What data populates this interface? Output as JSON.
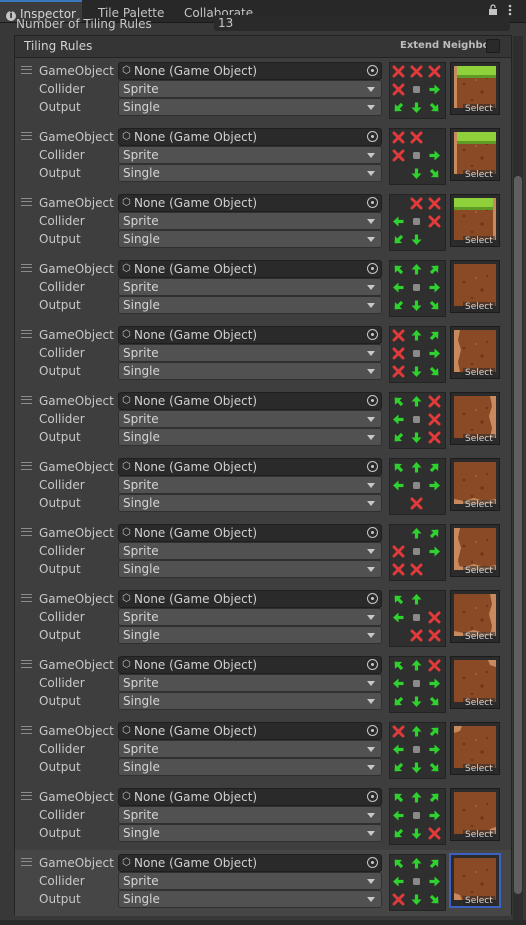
{
  "tabs": [
    {
      "label": "Inspector",
      "active": true
    },
    {
      "label": "Tile Palette",
      "active": false
    },
    {
      "label": "Collaborate",
      "active": false
    }
  ],
  "window_icons": {
    "lock": "lock-icon",
    "menu": "kebab-menu-icon"
  },
  "number_of_rules": {
    "label": "Number of Tiling Rules",
    "value": "13"
  },
  "tiling_rules": {
    "title": "Tiling Rules",
    "extend_neighbor_label": "Extend Neighbor",
    "extend_neighbor_checked": false
  },
  "field_labels": {
    "gameobject": "GameObject",
    "collider": "Collider",
    "output": "Output",
    "select": "Select"
  },
  "colors": {
    "accent": "#3a79bb",
    "arrow_green": "#2fd12f",
    "x_red": "#e23a3a",
    "grass": "#8fd13a",
    "dirt": "#8a4a26"
  },
  "rules": [
    {
      "gameobject": "None (Game Object)",
      "collider": "Sprite",
      "output": "Single",
      "neighbors": [
        "x",
        "x",
        "x",
        "x",
        "c",
        "right",
        "downleft",
        "down",
        "downright"
      ],
      "sprite": "grass-top-left",
      "selected": false
    },
    {
      "gameobject": "None (Game Object)",
      "collider": "Sprite",
      "output": "Single",
      "neighbors": [
        "x",
        "x",
        "",
        "x",
        "c",
        "right",
        "",
        "down",
        "downright"
      ],
      "sprite": "grass-top-left-edge",
      "selected": false
    },
    {
      "gameobject": "None (Game Object)",
      "collider": "Sprite",
      "output": "Single",
      "neighbors": [
        "",
        "x",
        "x",
        "left",
        "c",
        "x",
        "downleft",
        "down",
        ""
      ],
      "sprite": "grass-top-right",
      "selected": false
    },
    {
      "gameobject": "None (Game Object)",
      "collider": "Sprite",
      "output": "Single",
      "neighbors": [
        "upleft",
        "up",
        "upright",
        "left",
        "c",
        "right",
        "downleft",
        "down",
        "downright"
      ],
      "sprite": "dirt-center",
      "selected": false
    },
    {
      "gameobject": "None (Game Object)",
      "collider": "Sprite",
      "output": "Single",
      "neighbors": [
        "x",
        "up",
        "upright",
        "x",
        "c",
        "right",
        "x",
        "down",
        "downright"
      ],
      "sprite": "dirt-left-edge",
      "selected": false
    },
    {
      "gameobject": "None (Game Object)",
      "collider": "Sprite",
      "output": "Single",
      "neighbors": [
        "upleft",
        "up",
        "x",
        "left",
        "c",
        "x",
        "downleft",
        "down",
        "x"
      ],
      "sprite": "dirt-right-edge",
      "selected": false
    },
    {
      "gameobject": "None (Game Object)",
      "collider": "Sprite",
      "output": "Single",
      "neighbors": [
        "upleft",
        "up",
        "upright",
        "left",
        "c",
        "right",
        "",
        "x",
        ""
      ],
      "sprite": "dirt-bottom",
      "selected": false
    },
    {
      "gameobject": "None (Game Object)",
      "collider": "Sprite",
      "output": "Single",
      "neighbors": [
        "",
        "up",
        "upright",
        "x",
        "c",
        "right",
        "x",
        "x",
        ""
      ],
      "sprite": "dirt-bottom-left",
      "selected": false
    },
    {
      "gameobject": "None (Game Object)",
      "collider": "Sprite",
      "output": "Single",
      "neighbors": [
        "upleft",
        "up",
        "",
        "left",
        "c",
        "x",
        "",
        "x",
        "x"
      ],
      "sprite": "dirt-bottom-right",
      "selected": false
    },
    {
      "gameobject": "None (Game Object)",
      "collider": "Sprite",
      "output": "Single",
      "neighbors": [
        "upleft",
        "up",
        "x",
        "left",
        "c",
        "right",
        "downleft",
        "down",
        "downright"
      ],
      "sprite": "dirt-inner-top-right",
      "selected": false
    },
    {
      "gameobject": "None (Game Object)",
      "collider": "Sprite",
      "output": "Single",
      "neighbors": [
        "x",
        "up",
        "upright",
        "left",
        "c",
        "right",
        "downleft",
        "down",
        "downright"
      ],
      "sprite": "dirt-inner-top-left",
      "selected": false
    },
    {
      "gameobject": "None (Game Object)",
      "collider": "Sprite",
      "output": "Single",
      "neighbors": [
        "upleft",
        "up",
        "upright",
        "left",
        "c",
        "right",
        "downleft",
        "down",
        "x"
      ],
      "sprite": "dirt-inner-bottom-right",
      "selected": false
    },
    {
      "gameobject": "None (Game Object)",
      "collider": "Sprite",
      "output": "Single",
      "neighbors": [
        "upleft",
        "up",
        "upright",
        "left",
        "c",
        "right",
        "x",
        "down",
        "downright"
      ],
      "sprite": "dirt-inner-bottom-left",
      "selected": true
    }
  ]
}
